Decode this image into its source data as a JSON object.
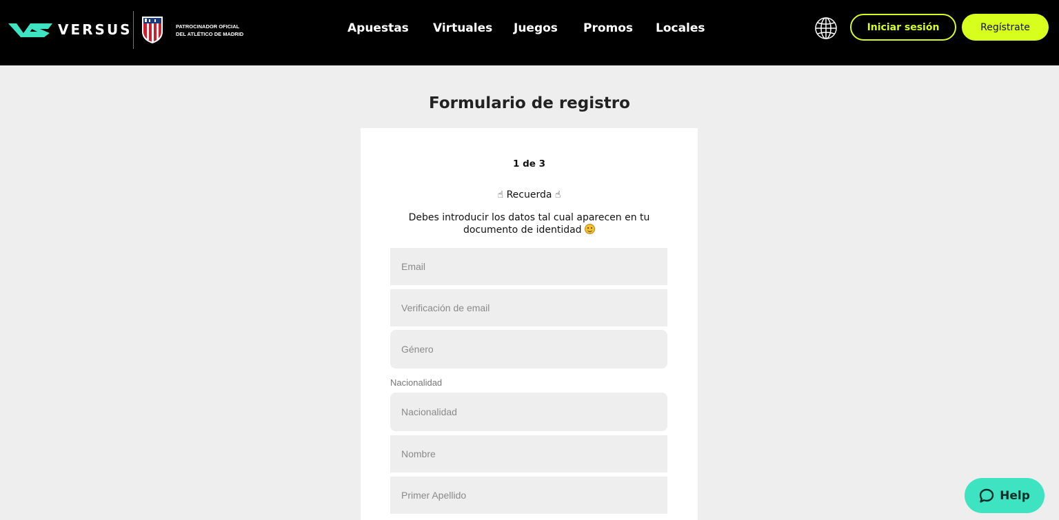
{
  "header": {
    "brand": "VERSUS",
    "sponsor_line1": "PATROCINADOR OFICIAL",
    "sponsor_line2": "DEL ATLÉTICO DE MADRID",
    "nav": [
      "Apuestas",
      "Virtuales",
      "Juegos",
      "Promos",
      "Locales"
    ],
    "login_label": "Iniciar sesión",
    "register_label": "Regístrate",
    "accent_color": "#d7ff1e",
    "icons": [
      "versus-logo-icon",
      "atletico-crest-icon",
      "globe-icon"
    ]
  },
  "main": {
    "title": "Formulario de registro",
    "step": "1 de 3",
    "remember": "Recuerda",
    "note": "Debes introducir los datos tal cual aparecen en tu documento de identidad",
    "fields": {
      "email_placeholder": "Email",
      "email_verify_placeholder": "Verificación de email",
      "gender_placeholder": "Género",
      "nationality_label": "Nacionalidad",
      "nationality_placeholder": "Nacionalidad",
      "name_placeholder": "Nombre",
      "lastname_placeholder": "Primer Apellido"
    }
  },
  "help": {
    "label": "Help",
    "color": "#3ee3c2"
  }
}
